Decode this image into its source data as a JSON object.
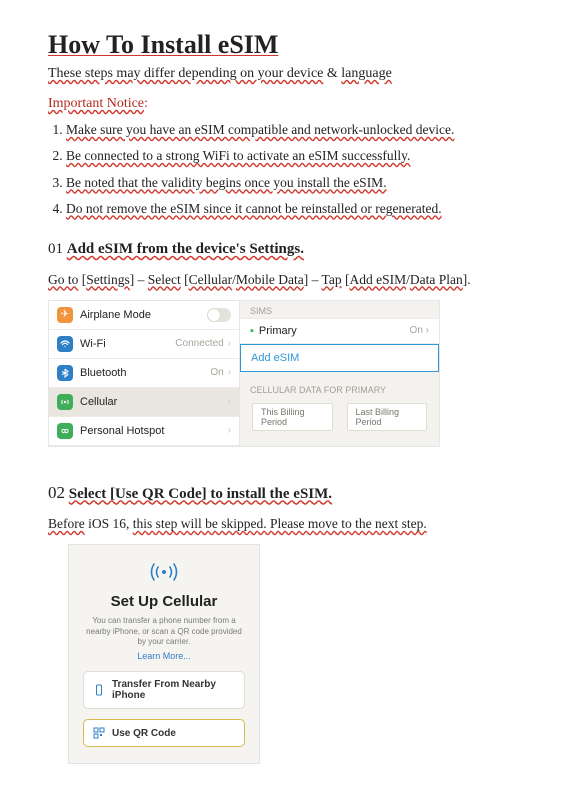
{
  "title": "How To Install eSIM",
  "subtitle_a": "These steps may differ depending on your device",
  "subtitle_amp": "&",
  "subtitle_b": "language",
  "important": "Important Notice",
  "colon": ":",
  "notices": [
    "Make sure you have an eSIM compatible and network-unlocked device.",
    "Be connected to a strong WiFi to activate an eSIM successfully.",
    "Be noted that the validity begins once you install the eSIM.",
    "Do not remove the eSIM since it cannot be reinstalled or regenerated."
  ],
  "step01": {
    "num": "01",
    "title": "Add eSIM from the device's Settings.",
    "desc_parts": [
      "Go to",
      " [",
      "Settings",
      "] – ",
      "Select",
      " [",
      "Cellular",
      "/",
      "Mobile Data",
      "] – ",
      "Tap",
      " [",
      "Add eSIM",
      "/",
      "Data Plan",
      "]."
    ]
  },
  "settings": {
    "airplane": "Airplane Mode",
    "wifi": "Wi-Fi",
    "wifi_status": "Connected",
    "bluetooth": "Bluetooth",
    "bt_status": "On",
    "cellular": "Cellular",
    "hotspot": "Personal Hotspot",
    "sims_label": "SIMs",
    "primary": "Primary",
    "primary_on": "On",
    "add_esim": "Add eSIM",
    "cell_data_label": "CELLULAR DATA FOR PRIMARY",
    "tab1": "This Billing Period",
    "tab2": "Last Billing Period"
  },
  "step02": {
    "num": "02",
    "title": "Select [Use QR Code] to install the eSIM.",
    "desc_a": "Before",
    "desc_b": " iOS 16, ",
    "desc_c": "this step will be skipped. Please move to the next step."
  },
  "setup": {
    "heading": "Set Up Cellular",
    "blurb": "You can transfer a phone number from a nearby iPhone, or scan a QR code provided by your carrier.",
    "learn": "Learn More...",
    "opt1": "Transfer From Nearby iPhone",
    "opt2": "Use QR Code"
  }
}
